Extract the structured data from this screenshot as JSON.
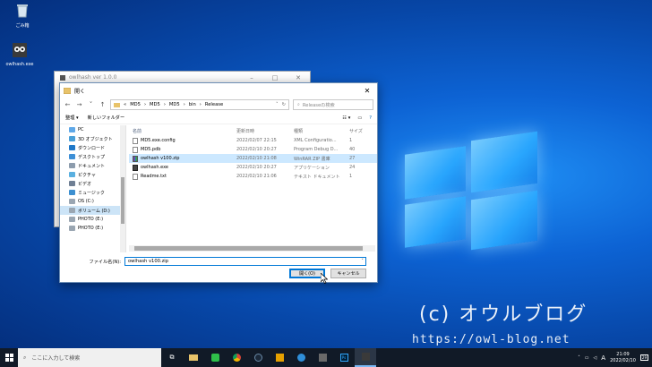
{
  "desktop": {
    "icons": [
      {
        "label": "ごみ箱",
        "icon": "recycle-bin-icon"
      },
      {
        "label": "owlhash.exe",
        "icon": "owl-app-icon"
      }
    ]
  },
  "back_window": {
    "title": "owlhash ver 1.0.0"
  },
  "dialog": {
    "title": "開く",
    "breadcrumb": [
      "MD5",
      "MD5",
      "MD5",
      "bin",
      "Release"
    ],
    "search_placeholder": "Releaseの検索",
    "toolbar": {
      "organize": "整理 ▾",
      "new_folder": "新しいフォルダー"
    },
    "sidebar": [
      {
        "label": "PC",
        "icon": "pc-icon",
        "selected": false
      },
      {
        "label": "3D オブジェクト",
        "icon": "cube-icon",
        "selected": false
      },
      {
        "label": "ダウンロード",
        "icon": "download-icon",
        "selected": false
      },
      {
        "label": "デスクトップ",
        "icon": "desktop-icon",
        "selected": false
      },
      {
        "label": "ドキュメント",
        "icon": "document-icon",
        "selected": false
      },
      {
        "label": "ピクチャ",
        "icon": "picture-icon",
        "selected": false
      },
      {
        "label": "ビデオ",
        "icon": "video-icon",
        "selected": false
      },
      {
        "label": "ミュージック",
        "icon": "music-icon",
        "selected": false
      },
      {
        "label": "OS (C:)",
        "icon": "drive-icon",
        "selected": false
      },
      {
        "label": "ボリューム (D:)",
        "icon": "drive-icon",
        "selected": true
      },
      {
        "label": "PHOTO (E:)",
        "icon": "drive-icon",
        "selected": false
      },
      {
        "label": "PHOTO (E:)",
        "icon": "drive-icon",
        "selected": false
      }
    ],
    "columns": {
      "name": "名前",
      "date": "更新日時",
      "type": "種類",
      "size": "サイズ"
    },
    "files": [
      {
        "name": "MD5.exe.config",
        "date": "2022/02/07 22:15",
        "type": "XML Configuratio...",
        "size": "1",
        "icon": "config-file-icon",
        "selected": false
      },
      {
        "name": "MD5.pdb",
        "date": "2022/02/10 20:27",
        "type": "Program Debug D...",
        "size": "40",
        "icon": "pdb-file-icon",
        "selected": false
      },
      {
        "name": "owlhash v100.zip",
        "date": "2022/02/10 21:08",
        "type": "WinRAR ZIP 書庫",
        "size": "27",
        "icon": "zip-file-icon",
        "selected": true
      },
      {
        "name": "owlhash.exe",
        "date": "2022/02/10 20:27",
        "type": "アプリケーション",
        "size": "24",
        "icon": "exe-file-icon",
        "selected": false
      },
      {
        "name": "Readme.txt",
        "date": "2022/02/10 21:06",
        "type": "テキスト ドキュメント",
        "size": "1",
        "icon": "text-file-icon",
        "selected": false
      }
    ],
    "filename_label": "ファイル名(N):",
    "filename_value": "owlhash v100.zip",
    "open_button": "開く(O)",
    "cancel_button": "キャンセル"
  },
  "watermark": {
    "line1": "(c) オウルブログ",
    "line2": "https://owl-blog.net"
  },
  "taskbar": {
    "search_placeholder": "ここに入力して検索",
    "time": "21:09",
    "date": "2022/02/10",
    "ime": "A",
    "notification_count": "29"
  },
  "colors": {
    "accent": "#0078d7",
    "selection": "#cce8ff",
    "taskbar": "#111a27"
  }
}
